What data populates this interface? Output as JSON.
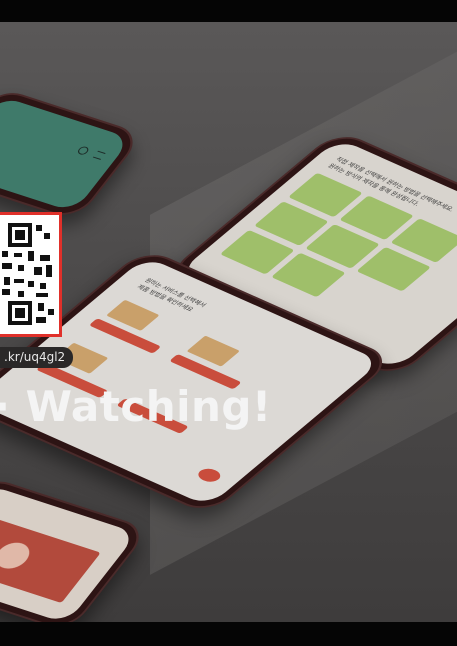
{
  "overlay": {
    "url_text": ".kr/uq4gl2",
    "headline": "· Watching!"
  },
  "phones": {
    "right_phone": {
      "header_line1": "직접 제작을 선택해서 원하는 방법을 선택해주세요.",
      "header_line2": "원하는 방식의 제작을 통해 완성됩니다."
    },
    "center_phone": {
      "header_line1": "원하는 서비스를 선택해서",
      "header_line2": "제품 방법을 확인하세요"
    }
  },
  "colors": {
    "accent_red": "#e0302a",
    "button_red": "#c94d3c",
    "phone_frame": "#2d1414",
    "card_green": "#9fbf6a"
  },
  "icons": [
    "qr-code-icon"
  ]
}
